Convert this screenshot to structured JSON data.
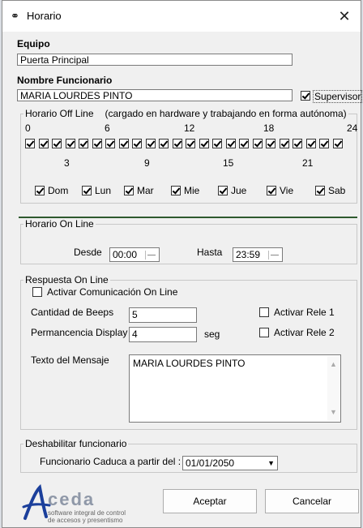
{
  "window": {
    "title": "Horario"
  },
  "equipo": {
    "label": "Equipo",
    "value": "Puerta Principal"
  },
  "funcionario": {
    "label": "Nombre Funcionario",
    "value": "MARIA LOURDES PINTO",
    "supervisor_label": "Supervisor",
    "supervisor_checked": true
  },
  "offline": {
    "legend": "Horario Off Line",
    "note": "(cargado en hardware y trabajando en forma autónoma)",
    "hours_top": [
      "0",
      "6",
      "12",
      "18",
      "24"
    ],
    "hours_bottom": [
      "3",
      "9",
      "15",
      "21"
    ],
    "hour_checks": 24,
    "days": [
      {
        "label": "Dom",
        "checked": true
      },
      {
        "label": "Lun",
        "checked": true
      },
      {
        "label": "Mar",
        "checked": true
      },
      {
        "label": "Mie",
        "checked": true
      },
      {
        "label": "Jue",
        "checked": true
      },
      {
        "label": "Vie",
        "checked": true
      },
      {
        "label": "Sab",
        "checked": true
      }
    ]
  },
  "online": {
    "legend": "Horario On Line",
    "desde_label": "Desde",
    "desde_value": "00:00",
    "hasta_label": "Hasta",
    "hasta_value": "23:59"
  },
  "respuesta": {
    "legend": "Respuesta On Line",
    "activar_label": "Activar Comunicación On Line",
    "beeps_label": "Cantidad de Beeps",
    "beeps_value": "5",
    "display_label": "Permancencia Display",
    "display_value": "4",
    "seg_label": "seg",
    "rele1_label": "Activar Rele 1",
    "rele2_label": "Activar Rele 2",
    "mensaje_label": "Texto del Mensaje",
    "mensaje_value": "MARIA LOURDES PINTO"
  },
  "deshabilitar": {
    "legend": "Deshabilitar funcionario",
    "caduca_label": "Funcionario Caduca a partir del :",
    "caduca_value": "01/01/2050"
  },
  "logo": {
    "name": "ceda",
    "subtitle_1": "software integral de control",
    "subtitle_2": "de accesos y presentismo"
  },
  "buttons": {
    "aceptar": "Aceptar",
    "cancelar": "Cancelar"
  }
}
